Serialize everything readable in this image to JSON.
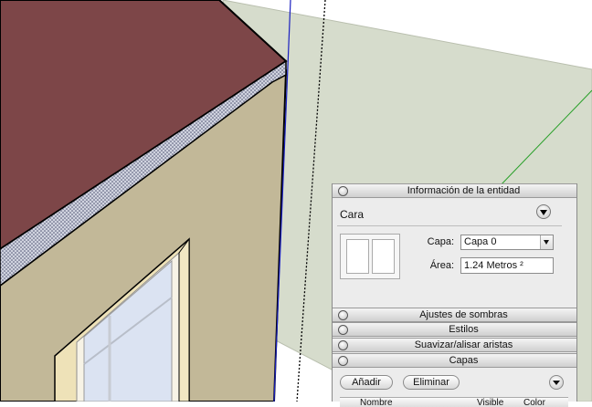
{
  "tray": {
    "entity_info": {
      "title": "Información de la entidad",
      "entity_type": "Cara",
      "layer_label": "Capa:",
      "layer_value": "Capa 0",
      "area_label": "Área:",
      "area_value": "1.24 Metros ²"
    },
    "collapsed_panels": [
      {
        "title": "Ajustes de sombras"
      },
      {
        "title": "Estilos"
      },
      {
        "title": "Suavizar/alisar aristas"
      }
    ],
    "layers": {
      "title": "Capas",
      "add_label": "Añadir",
      "remove_label": "Eliminar",
      "columns": [
        "Nombre",
        "Visible",
        "Color"
      ]
    }
  },
  "colors": {
    "roof": "#7d4648",
    "roof_edge": "#c9ccd8",
    "wall": "#c2b898",
    "wall_dark": "#b4ab89",
    "ground": "#d6dccc",
    "window_frame": "#f1e7c3",
    "glass": "#dbe3f2",
    "axis_blue": "#1a1fc0",
    "axis_green": "#2aa02a"
  },
  "icons": [
    "panel-toggle-icon",
    "disclosure-icon",
    "face-swatch-icon",
    "dropdown-arrow-icon",
    "panel-menu-icon"
  ]
}
